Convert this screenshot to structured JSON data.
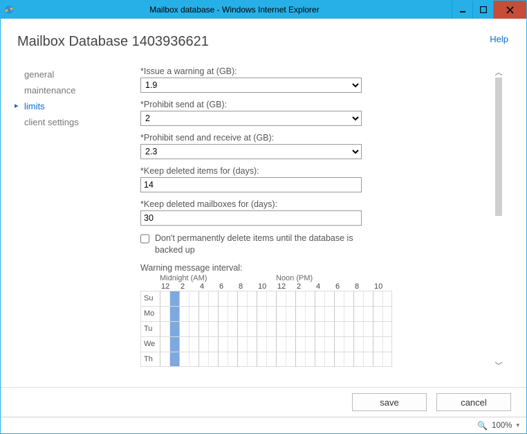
{
  "window": {
    "title": "Mailbox database - Windows Internet Explorer"
  },
  "header": {
    "help_label": "Help",
    "page_title": "Mailbox Database 1403936621"
  },
  "sidebar": {
    "items": [
      {
        "label": "general",
        "selected": false
      },
      {
        "label": "maintenance",
        "selected": false
      },
      {
        "label": "limits",
        "selected": true
      },
      {
        "label": "client settings",
        "selected": false
      }
    ]
  },
  "form": {
    "warning_label": "*Issue a warning at (GB):",
    "warning_value": "1.9",
    "prohibit_send_label": "*Prohibit send at (GB):",
    "prohibit_send_value": "2",
    "prohibit_sr_label": "*Prohibit send and receive at (GB):",
    "prohibit_sr_value": "2.3",
    "keep_items_label": "*Keep deleted items for (days):",
    "keep_items_value": "14",
    "keep_mailboxes_label": "*Keep deleted mailboxes for (days):",
    "keep_mailboxes_value": "30",
    "dont_delete_label": "Don't permanently delete items until the database is backed up",
    "dont_delete_checked": false,
    "interval_label": "Warning message interval:"
  },
  "schedule": {
    "midnight_label": "Midnight (AM)",
    "noon_label": "Noon (PM)",
    "hours": [
      "12",
      "2",
      "4",
      "6",
      "8",
      "10",
      "12",
      "2",
      "4",
      "6",
      "8",
      "10"
    ],
    "days": [
      "Su",
      "Mo",
      "Tu",
      "We",
      "Th"
    ],
    "selected_column_index": 1
  },
  "buttons": {
    "save": "save",
    "cancel": "cancel"
  },
  "statusbar": {
    "zoom": "100%"
  }
}
